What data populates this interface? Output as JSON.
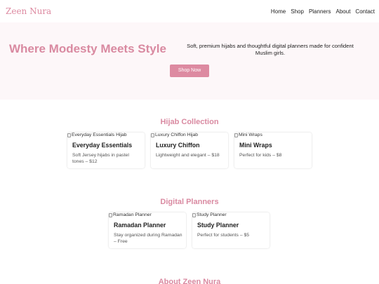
{
  "nav": {
    "brand": "Zeen Nura",
    "links": [
      "Home",
      "Shop",
      "Planners",
      "About",
      "Contact"
    ]
  },
  "hero": {
    "title": "Where Modesty Meets Style",
    "text": "Soft, premium hijabs and thoughtful digital planners made for confident Muslim girls.",
    "button": "Shop Now"
  },
  "hijab_section": {
    "title": "Hijab Collection",
    "cards": [
      {
        "img_alt": "Everyday Essentials Hijab",
        "title": "Everyday Essentials",
        "desc": "Soft Jersey hijabs in pastel tones – $12"
      },
      {
        "img_alt": "Luxury Chiffon Hijab",
        "title": "Luxury Chiffon",
        "desc": "Lightweight and elegant – $18"
      },
      {
        "img_alt": "Mini Wraps",
        "title": "Mini Wraps",
        "desc": "Perfect for kids – $8"
      }
    ]
  },
  "planner_section": {
    "title": "Digital Planners",
    "cards": [
      {
        "img_alt": "Ramadan Planner",
        "title": "Ramadan Planner",
        "desc": "Stay organized during Ramadan – Free"
      },
      {
        "img_alt": "Study Planner",
        "title": "Study Planner",
        "desc": "Perfect for students – $5"
      }
    ]
  },
  "about_section": {
    "title": "About Zeen Nura"
  },
  "colors": {
    "accent": "#dd8aa1",
    "hero_bg": "#fdf7f9"
  }
}
